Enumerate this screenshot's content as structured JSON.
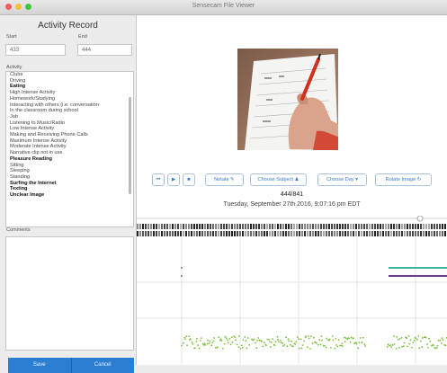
{
  "window": {
    "title": "Sensecam File Viewer",
    "traffic_light_colors": [
      "#f25f58",
      "#f9be2f",
      "#3ac841"
    ]
  },
  "sidebar": {
    "title": "Activity Record",
    "start_label": "Start",
    "end_label": "End",
    "start_value": "433",
    "end_value": "444",
    "activity_label": "Activity",
    "activities": [
      {
        "label": "Clubs",
        "bold": false
      },
      {
        "label": "Driving",
        "bold": false
      },
      {
        "label": "Eating",
        "bold": true
      },
      {
        "label": "High Intense Activity",
        "bold": false
      },
      {
        "label": "Homework/Studying",
        "bold": false
      },
      {
        "label": "Interacting with others (i.e. conversation",
        "bold": false
      },
      {
        "label": "In the classroom during school",
        "bold": false
      },
      {
        "label": "Job",
        "bold": false
      },
      {
        "label": "Listening to Music/Radio",
        "bold": false
      },
      {
        "label": "Low Intense Activity",
        "bold": false
      },
      {
        "label": "Making and Receiving Phone Calls",
        "bold": false
      },
      {
        "label": "Maximum Intense Activity",
        "bold": false
      },
      {
        "label": "Moderate Intense Activity",
        "bold": false
      },
      {
        "label": "Narrative clip not in use",
        "bold": false
      },
      {
        "label": "Pleasure Reading",
        "bold": true
      },
      {
        "label": "Sitting",
        "bold": false
      },
      {
        "label": "Sleeping",
        "bold": false
      },
      {
        "label": "Standing",
        "bold": false
      },
      {
        "label": "Surfing the Internet",
        "bold": true
      },
      {
        "label": "Texting",
        "bold": true
      },
      {
        "label": "Unclear Image",
        "bold": true
      }
    ],
    "comments_label": "Comments",
    "save_label": "Save",
    "cancel_label": "Cancel",
    "accent_color": "#2c7ed3"
  },
  "viewer": {
    "controls": {
      "first_icon": "⏮",
      "play_icon": "▶",
      "stop_icon": "■",
      "notate_label": "Notate ✎",
      "choose_subject_label": "Choose Subject ♟",
      "choose_day_label": "Choose Day ▾",
      "rotate_image_label": "Rotate Image ↻"
    },
    "frame_counter": "444/841",
    "timestamp": "Tuesday, September 27th 2016, 9:07:16 pm EDT"
  },
  "graph": {
    "line_colors": [
      "#3bb2a8",
      "#6a3b8c"
    ],
    "dot_color": "#7bbf3a"
  }
}
